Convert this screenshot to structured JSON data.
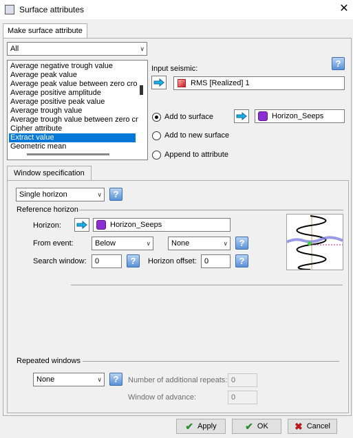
{
  "window": {
    "title": "Surface attributes"
  },
  "tabs": {
    "main": "Make surface attribute",
    "window_spec": "Window specification"
  },
  "filter": {
    "value": "All"
  },
  "attributes": [
    "Average negative trough value",
    "Average peak value",
    "Average peak value between zero cro",
    "Average positive amplitude",
    "Average positive peak value",
    "Average trough value",
    "Average trough value between zero cr",
    "Cipher attribute",
    "Extract value",
    "Geometric mean"
  ],
  "selected_attribute": "Extract value",
  "input_seismic": {
    "label": "Input seismic:",
    "value": "RMS [Realized] 1"
  },
  "output": {
    "add_to_surface": "Add to surface",
    "add_to_new_surface": "Add to new surface",
    "append_to_attribute": "Append to attribute",
    "selected": "add_to_surface",
    "surface_value": "Horizon_Seeps"
  },
  "window_spec": {
    "mode": "Single horizon",
    "reference_horizon_heading": "Reference horizon",
    "horizon_label": "Horizon:",
    "horizon_value": "Horizon_Seeps",
    "from_event_label": "From event:",
    "from_event_value": "Below",
    "from_event_second": "None",
    "search_window_label": "Search window:",
    "search_window_value": "0",
    "horizon_offset_label": "Horizon offset:",
    "horizon_offset_value": "0"
  },
  "repeated": {
    "heading": "Repeated windows",
    "mode": "None",
    "additional_repeats_label": "Number of additional repeats:",
    "additional_repeats_value": "0",
    "window_advance_label": "Window of advance:",
    "window_advance_value": "0"
  },
  "buttons": {
    "apply": "Apply",
    "ok": "OK",
    "cancel": "Cancel"
  },
  "colors": {
    "accent": "#0078d7",
    "check": "#2e8b2e",
    "cancel": "#c0161b",
    "horizon_icon": "#8c2fd0"
  }
}
